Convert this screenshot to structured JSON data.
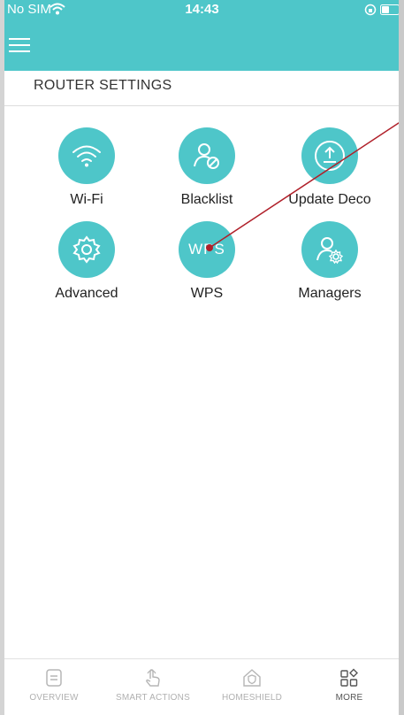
{
  "status_bar": {
    "carrier": "No SIM",
    "time": "14:43"
  },
  "section": {
    "title": "ROUTER SETTINGS"
  },
  "tiles": [
    {
      "label": "Wi-Fi",
      "icon": "wifi-icon"
    },
    {
      "label": "Blacklist",
      "icon": "user-blocked-icon"
    },
    {
      "label": "Update Deco",
      "icon": "upload-icon"
    },
    {
      "label": "Advanced",
      "icon": "gear-icon"
    },
    {
      "label": "WPS",
      "icon_text": "WPS"
    },
    {
      "label": "Managers",
      "icon": "user-gear-icon"
    }
  ],
  "bottom_nav": [
    {
      "label": "OVERVIEW",
      "icon": "document-icon",
      "active": false
    },
    {
      "label": "SMART ACTIONS",
      "icon": "tap-hand-icon",
      "active": false
    },
    {
      "label": "HOMESHIELD",
      "icon": "house-shield-icon",
      "active": false
    },
    {
      "label": "MORE",
      "icon": "grid-more-icon",
      "active": true
    }
  ],
  "colors": {
    "accent": "#4ec6c9",
    "annotation": "#b0202a"
  }
}
